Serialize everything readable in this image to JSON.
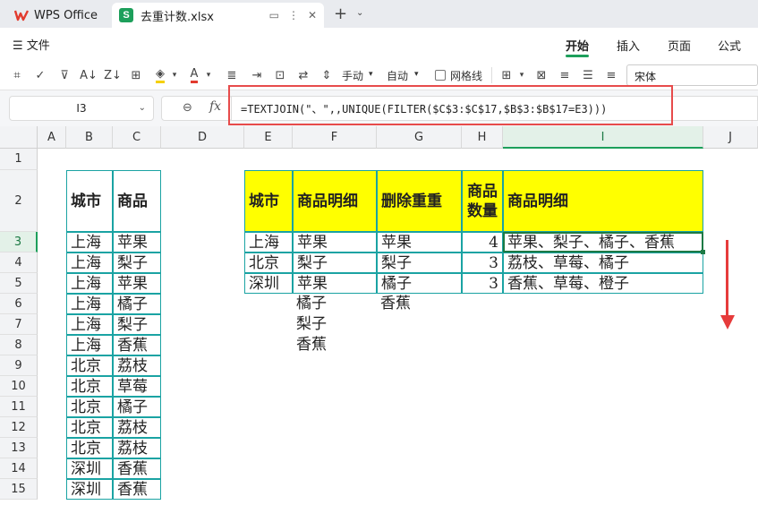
{
  "tabs": {
    "home": "WPS Office",
    "file": "去重计数.xlsx"
  },
  "menu": {
    "file": "文件",
    "tabs": [
      "开始",
      "插入",
      "页面",
      "公式"
    ],
    "active": "开始"
  },
  "toolbar": {
    "manual": "手动",
    "auto": "自动",
    "gridlines": "网格线",
    "font": "宋体"
  },
  "formula_bar": {
    "cell_ref": "I3",
    "fx": "fx",
    "formula": "=TEXTJOIN(\"、\",,UNIQUE(FILTER($C$3:$C$17,$B$3:$B$17=E3)))"
  },
  "columns": [
    "A",
    "B",
    "C",
    "D",
    "E",
    "F",
    "G",
    "H",
    "I",
    "J"
  ],
  "rows": [
    "1",
    "2",
    "3",
    "4",
    "5",
    "6",
    "7",
    "8",
    "9",
    "10",
    "11",
    "12",
    "13",
    "14",
    "15"
  ],
  "source_table": {
    "headers": [
      "城市",
      "商品"
    ],
    "rows": [
      [
        "上海",
        "苹果"
      ],
      [
        "上海",
        "梨子"
      ],
      [
        "上海",
        "苹果"
      ],
      [
        "上海",
        "橘子"
      ],
      [
        "上海",
        "梨子"
      ],
      [
        "上海",
        "香蕉"
      ],
      [
        "北京",
        "荔枝"
      ],
      [
        "北京",
        "草莓"
      ],
      [
        "北京",
        "橘子"
      ],
      [
        "北京",
        "荔枝"
      ],
      [
        "北京",
        "荔枝"
      ],
      [
        "深圳",
        "香蕉"
      ],
      [
        "深圳",
        "香蕉"
      ]
    ]
  },
  "result_table": {
    "headers": [
      "城市",
      "商品明细",
      "删除重重",
      "商品数量",
      "商品明细"
    ],
    "header_qty_line1": "商品",
    "header_qty_line2": "数量",
    "rows": [
      [
        "上海",
        "苹果",
        "苹果",
        "4",
        "苹果、梨子、橘子、香蕉"
      ],
      [
        "北京",
        "梨子",
        "梨子",
        "3",
        "荔枝、草莓、橘子"
      ],
      [
        "深圳",
        "苹果",
        "橘子",
        "3",
        "香蕉、草莓、橙子"
      ]
    ],
    "spill_f": [
      "橘子",
      "梨子",
      "香蕉"
    ],
    "spill_g": [
      "香蕉"
    ]
  }
}
